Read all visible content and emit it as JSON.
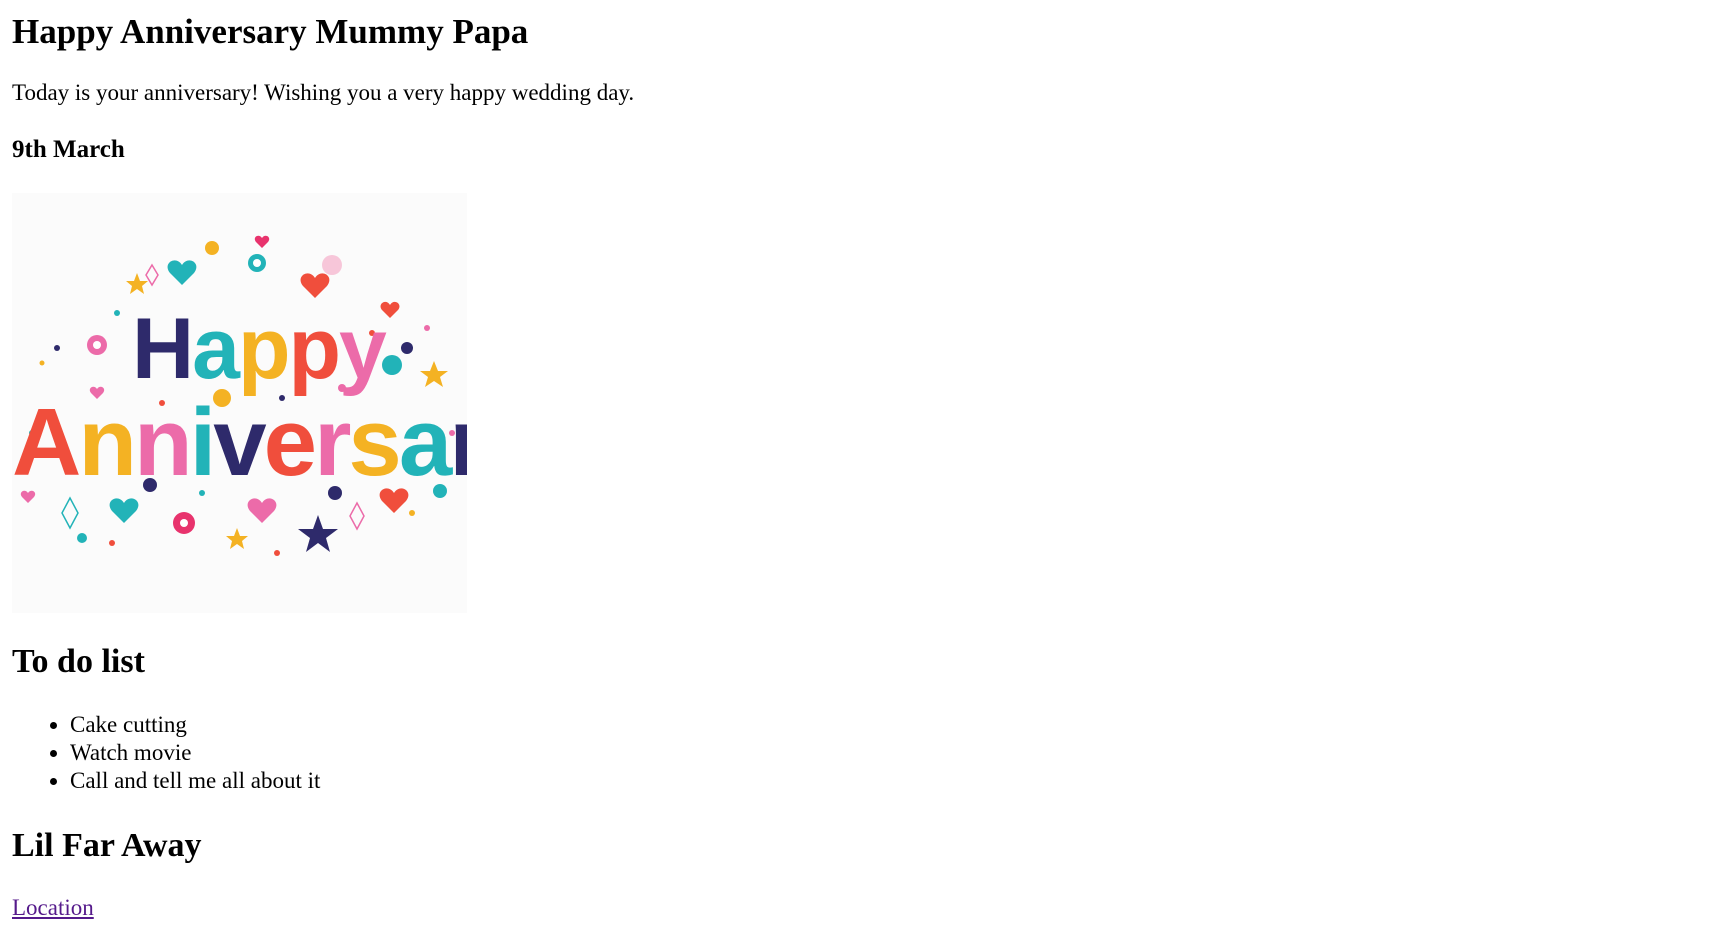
{
  "page": {
    "title": "Happy Anniversary Mummy Papa",
    "intro": "Today is your anniversary! Wishing you a very happy wedding day.",
    "date": "9th March"
  },
  "image": {
    "word_top": "Happy",
    "word_bottom": "Anniversary",
    "letter_colors": [
      "#2e2a6b",
      "#22b3b8",
      "#f4b223",
      "#f04e3c",
      "#ec6ba9"
    ]
  },
  "todo": {
    "heading": "To do list",
    "items": [
      "Cake cutting",
      "Watch movie",
      "Call and tell me all about it"
    ]
  },
  "far": {
    "heading": "Lil Far Away",
    "link_text": "Location",
    "link_color": "#551a8b"
  }
}
